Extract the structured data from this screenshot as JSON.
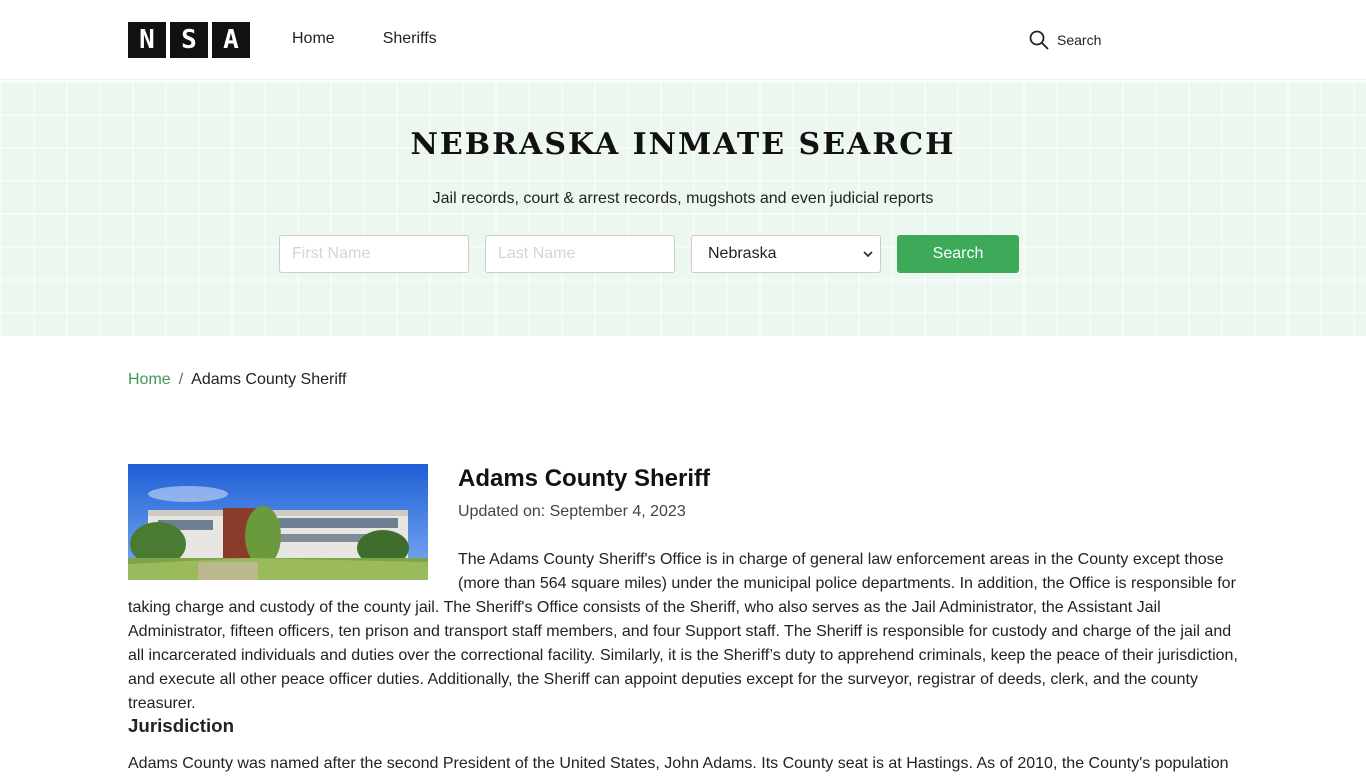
{
  "header": {
    "logo": [
      "N",
      "S",
      "A"
    ],
    "nav": [
      {
        "label": "Home"
      },
      {
        "label": "Sheriffs"
      }
    ],
    "search_label": "Search",
    "search_icon": "search-icon"
  },
  "hero": {
    "title": "NEBRASKA INMATE SEARCH",
    "subtitle": "Jail records, court & arrest records, mugshots and even judicial reports",
    "first_name_placeholder": "First Name",
    "last_name_placeholder": "Last Name",
    "state_selected": "Nebraska",
    "search_button": "Search",
    "accent_color": "#3daa5a"
  },
  "breadcrumb": {
    "home": "Home",
    "separator": "/",
    "current": "Adams County Sheriff"
  },
  "article": {
    "title": "Adams County Sheriff",
    "updated": "Updated on: September 4, 2023",
    "paragraph": "The Adams County Sheriff's Office is in charge of general law enforcement areas in the County except those (more than 564 square miles) under the municipal police departments. In addition, the Office is responsible for taking charge and custody of the county jail. The Sheriff's Office consists of the Sheriff, who also serves as the Jail Administrator, the Assistant Jail Administrator, fifteen officers, ten prison and transport staff members, and four Support staff. The Sheriff is responsible for custody and charge of the jail and all incarcerated individuals and duties over the correctional facility. Similarly, it is the Sheriff’s duty to apprehend criminals, keep the peace of their jurisdiction, and execute all other peace officer duties. Additionally, the Sheriff can appoint deputies except for the surveyor, registrar of deeds, clerk, and the county treasurer.",
    "subheading": "Jurisdiction",
    "next_paragraph": "Adams County was named after the second President of the United States, John Adams. Its County seat is at Hastings. As of 2010, the County's population"
  }
}
